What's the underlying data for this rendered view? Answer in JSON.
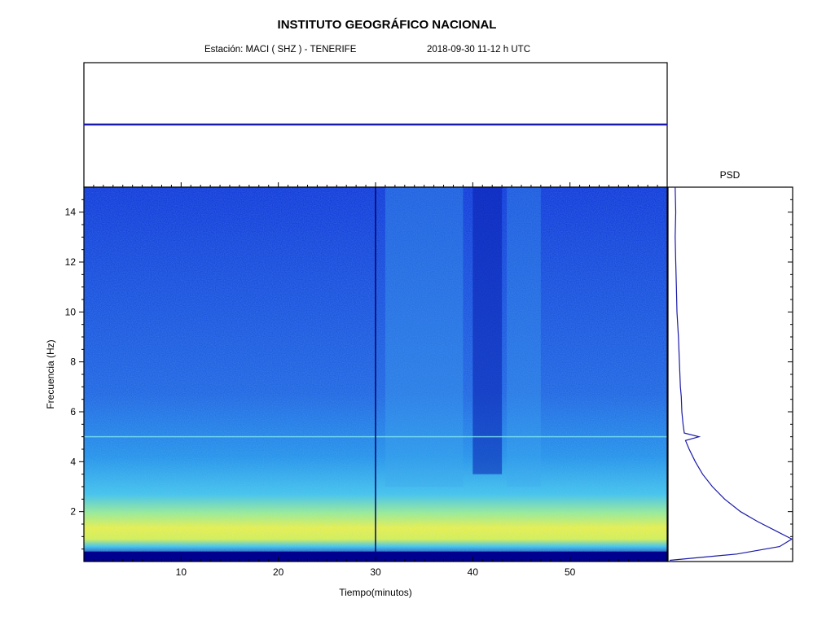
{
  "header": {
    "title": "INSTITUTO GEOGRÁFICO NACIONAL",
    "station": "Estación:  MACI ( SHZ ) - TENERIFE",
    "datetime": "2018-09-30  11-12 h UTC"
  },
  "chart_data": [
    {
      "type": "line",
      "panel": "seismogram",
      "description_hidden": true,
      "x": [
        0,
        60
      ],
      "values": [
        0,
        0
      ],
      "xlim": [
        0,
        60
      ],
      "color": "#1a1aa8"
    },
    {
      "type": "heatmap",
      "panel": "spectrogram",
      "xlabel": "Tiempo(minutos)",
      "ylabel": "Frecuencia  (Hz)",
      "xlim": [
        0,
        60
      ],
      "ylim": [
        0,
        15
      ],
      "xticks": [
        10,
        20,
        30,
        40,
        50
      ],
      "yticks": [
        2,
        4,
        6,
        8,
        10,
        12,
        14
      ],
      "xtick_labels": [
        "10",
        "20",
        "30",
        "40",
        "50"
      ],
      "ytick_labels": [
        "2",
        "4",
        "6",
        "8",
        "10",
        "12",
        "14"
      ],
      "colormap": [
        "#00008f",
        "#0a2fd6",
        "#1f7fe8",
        "#3fc3ea",
        "#9ef08a",
        "#f5f53a"
      ],
      "features": {
        "horizontal_line_hz": 5.0,
        "vertical_spike_min": 30,
        "quiet_band_min": [
          40,
          43
        ],
        "active_band_min": [
          31,
          39
        ]
      }
    },
    {
      "type": "line",
      "panel": "psd",
      "title": "PSD",
      "freq": [
        0.05,
        0.3,
        0.6,
        0.9,
        1.2,
        1.6,
        2.0,
        2.5,
        3.0,
        3.5,
        4.0,
        4.5,
        4.85,
        5.0,
        5.15,
        5.5,
        6.0,
        6.6,
        7.0,
        8.0,
        9.0,
        10.0,
        11.0,
        12.0,
        13.0,
        14.0,
        15.0
      ],
      "level": [
        0.0,
        0.55,
        0.9,
        1.0,
        0.88,
        0.72,
        0.58,
        0.45,
        0.35,
        0.27,
        0.21,
        0.16,
        0.13,
        0.24,
        0.12,
        0.11,
        0.1,
        0.095,
        0.088,
        0.08,
        0.072,
        0.06,
        0.055,
        0.05,
        0.045,
        0.05,
        0.045
      ],
      "color": "#1a1aa8"
    }
  ]
}
